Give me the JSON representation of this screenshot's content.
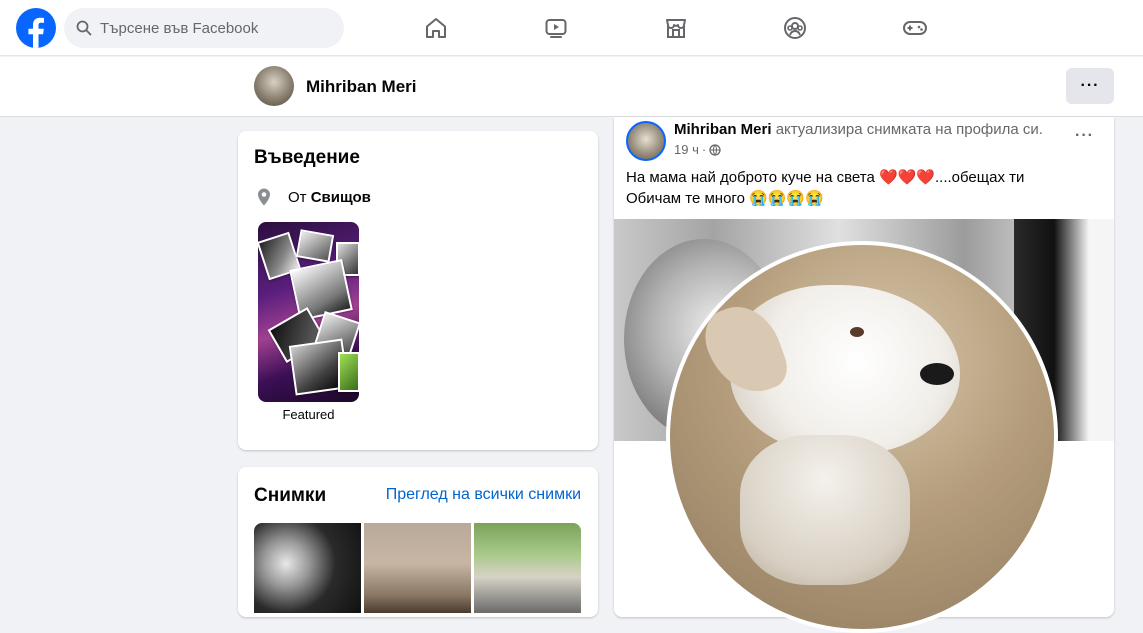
{
  "app": {
    "brand_color": "#0866ff",
    "search_placeholder": "Търсене във Facebook",
    "nav_icons": [
      "home-icon",
      "video-icon",
      "marketplace-icon",
      "groups-icon",
      "gaming-icon"
    ]
  },
  "profile_bar": {
    "name": "Mihriban Meri",
    "more_label": "···"
  },
  "intro": {
    "title": "Въведение",
    "from_prefix": "От",
    "from_place": "Свищов",
    "featured_label": "Featured"
  },
  "photos": {
    "title": "Снимки",
    "see_all": "Преглед на всички снимки"
  },
  "post": {
    "author": "Mihriban Meri",
    "action": "актуализира снимката на профила си.",
    "time": "19 ч",
    "separator": "·",
    "text_line1": "На мама най доброто куче на света ❤️❤️❤️....обещах ти",
    "text_line2": "Обичам те много 😭😭😭😭",
    "more_label": "···"
  }
}
